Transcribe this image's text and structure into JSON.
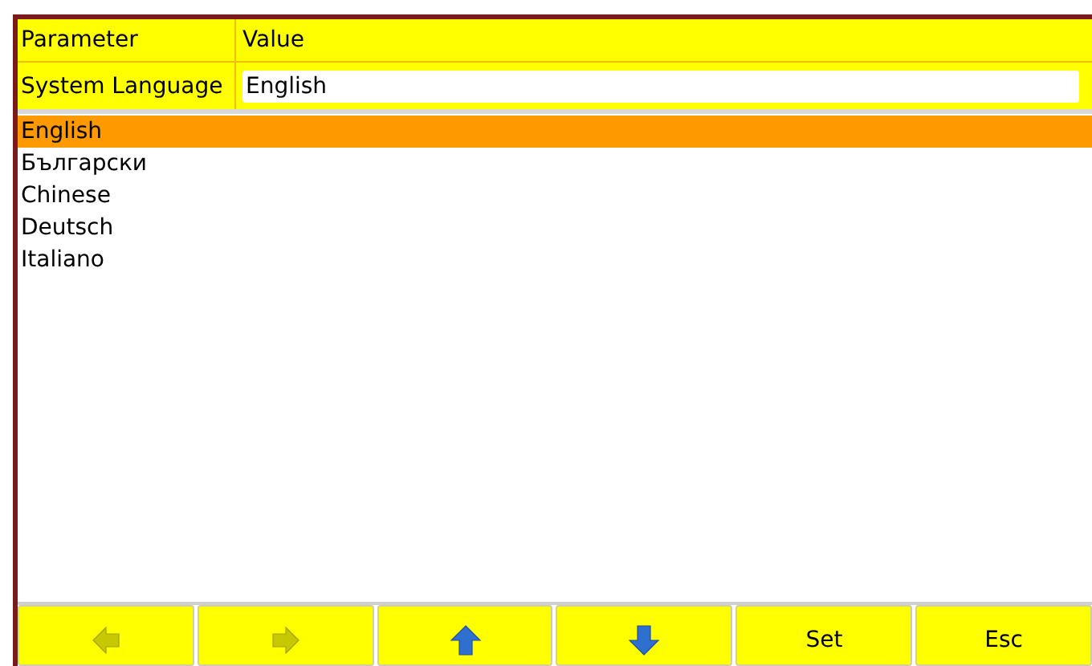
{
  "header": {
    "columns": [
      "Parameter",
      "Value"
    ]
  },
  "parameter": {
    "label": "System Language",
    "value": "English"
  },
  "options": [
    {
      "label": "English",
      "selected": true
    },
    {
      "label": "Български",
      "selected": false
    },
    {
      "label": "Chinese",
      "selected": false
    },
    {
      "label": "Deutsch",
      "selected": false
    },
    {
      "label": "Italiano",
      "selected": false
    }
  ],
  "buttons": [
    {
      "kind": "left",
      "disabled": true
    },
    {
      "kind": "right",
      "disabled": true
    },
    {
      "kind": "up",
      "disabled": false
    },
    {
      "kind": "down",
      "disabled": false
    },
    {
      "kind": "text",
      "label": "Set",
      "disabled": false
    },
    {
      "kind": "text",
      "label": "Esc",
      "disabled": false
    }
  ]
}
